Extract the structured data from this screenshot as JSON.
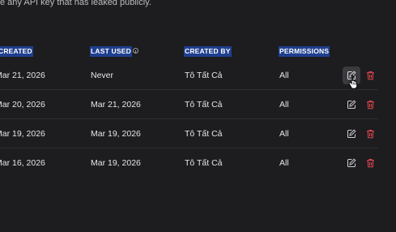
{
  "notice": "e any API key that has leaked publicly.",
  "columns": {
    "created": "CREATED",
    "last_used": "LAST USED",
    "created_by": "CREATED BY",
    "permissions": "PERMISSIONS"
  },
  "rows": [
    {
      "created": "Mar 21, 2026",
      "last_used": "Never",
      "created_by": "Tô Tất Cả",
      "permissions": "All"
    },
    {
      "created": "Mar 20, 2026",
      "last_used": "Mar 21, 2026",
      "created_by": "Tô Tất Cả",
      "permissions": "All"
    },
    {
      "created": "Mar 19, 2026",
      "last_used": "Mar 19, 2026",
      "created_by": "Tô Tất Cả",
      "permissions": "All"
    },
    {
      "created": "Mar 16, 2026",
      "last_used": "Mar 19, 2026",
      "created_by": "Tô Tất Cả",
      "permissions": "All"
    }
  ],
  "icons": {
    "edit": "pencil-square-icon",
    "delete": "trash-icon",
    "info": "info-circle-icon",
    "cursor": "hand-pointer-cursor"
  },
  "colors": {
    "background": "#1d1d20",
    "header_highlight": "#1f3f8f",
    "delete_red": "#e5484d",
    "icon_gray": "#cfcfd3"
  }
}
